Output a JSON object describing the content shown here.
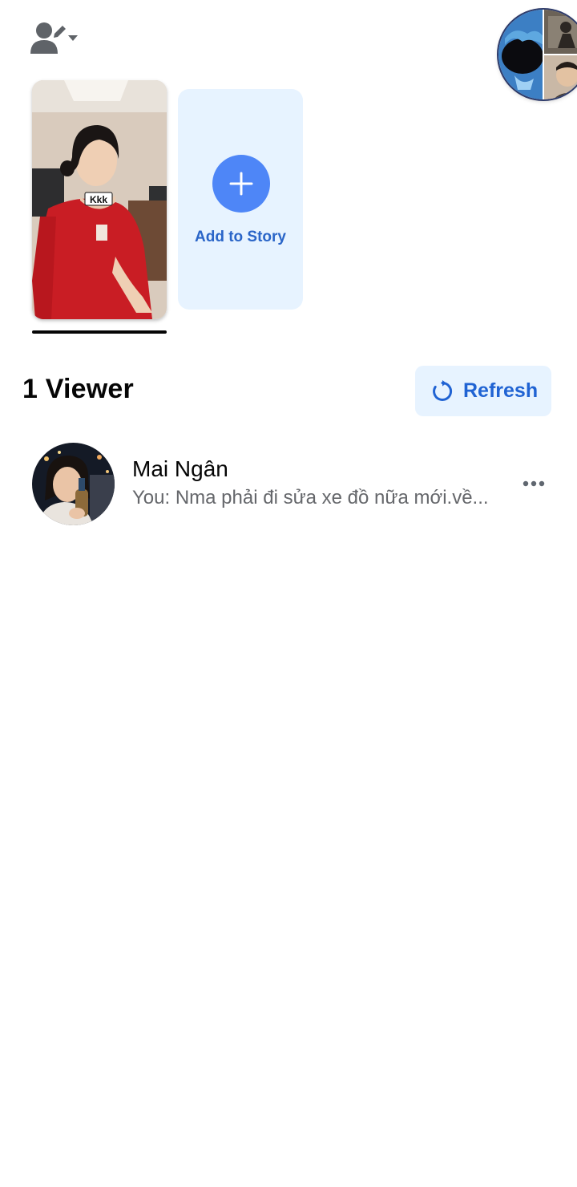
{
  "header": {
    "audience_icon": "person-pencil-icon",
    "audience_dropdown_icon": "caret-down-icon"
  },
  "stories": {
    "thumbnail": {
      "sticker_text": "Kkk"
    },
    "add_card": {
      "label": "Add to Story",
      "icon": "plus-icon"
    }
  },
  "viewers": {
    "title": "1 Viewer",
    "refresh_label": "Refresh",
    "refresh_icon": "refresh-icon",
    "items": [
      {
        "name": "Mai Ngân",
        "message": "You: Nma phải đi sửa xe đồ nữa mới.về...",
        "more_icon": "more-horizontal-icon"
      }
    ]
  },
  "colors": {
    "accent": "#4e86f7",
    "accent_text": "#2063d3",
    "card_bg": "#e7f3ff",
    "secondary_text": "#65676b"
  }
}
